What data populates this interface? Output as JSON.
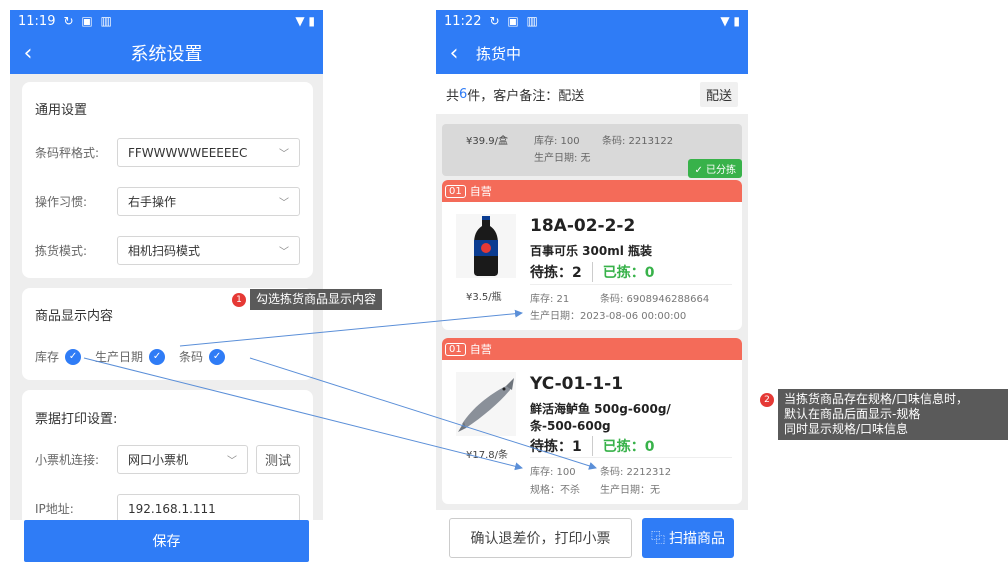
{
  "left_phone": {
    "status_time": "11:19",
    "title": "系统设置",
    "general": {
      "heading": "通用设置",
      "rows": [
        {
          "label": "条码秤格式:",
          "value": "FFWWWWWEEEEEC"
        },
        {
          "label": "操作习惯:",
          "value": "右手操作"
        },
        {
          "label": "拣货模式:",
          "value": "相机扫码模式"
        }
      ]
    },
    "display": {
      "heading": "商品显示内容",
      "options": [
        "库存",
        "生产日期",
        "条码"
      ]
    },
    "print": {
      "heading": "票据打印设置:",
      "printer_label": "小票机连接:",
      "printer_value": "网口小票机",
      "test_button": "测试",
      "ip_label": "IP地址:",
      "ip_value": "192.168.1.111"
    },
    "save_button": "保存"
  },
  "right_phone": {
    "status_time": "11:22",
    "title": "拣货中",
    "summary": {
      "prefix": "共",
      "count": "6",
      "suffix": "件，客户备注：配送",
      "tag": "配送"
    },
    "done_item": {
      "price": "¥39.9/盒",
      "stock": "库存: 100",
      "barcode": "条码: 2213122",
      "date": "生产日期: 无",
      "badge": "✓ 已分拣"
    },
    "items": [
      {
        "no": "01",
        "type": "自营",
        "location": "18A-02-2-2",
        "name": "百事可乐 300ml 瓶装",
        "to_pick": "待拣：2",
        "picked": "已拣：0",
        "price": "¥3.5/瓶",
        "stock": "库存: 21",
        "barcode": "条码: 6908946288664",
        "date": "生产日期：2023-08-06 00:00:00"
      },
      {
        "no": "01",
        "type": "自营",
        "location": "YC-01-1-1",
        "name": "鲜活海鲈鱼 500g-600g/",
        "name2": "条-500-600g",
        "to_pick": "待拣：1",
        "picked": "已拣：0",
        "price": "¥17.8/条",
        "stock": "库存: 100",
        "barcode": "条码: 2212312",
        "spec": "规格：不杀",
        "date": "生产日期：无"
      }
    ],
    "confirm_button": "确认退差价，打印小票",
    "scan_button": "扫描商品"
  },
  "annotations": [
    {
      "num": "1",
      "text": "勾选拣货商品显示内容"
    },
    {
      "num": "2",
      "lines": [
        "当拣货商品存在规格/口味信息时，",
        "默认在商品后面显示-规格",
        "同时显示规格/口味信息"
      ]
    }
  ],
  "colors": {
    "primary": "#2f7cf6",
    "accent_red": "#f46b59",
    "success": "#38b24a",
    "annotation_bg": "#5a5a5a"
  }
}
